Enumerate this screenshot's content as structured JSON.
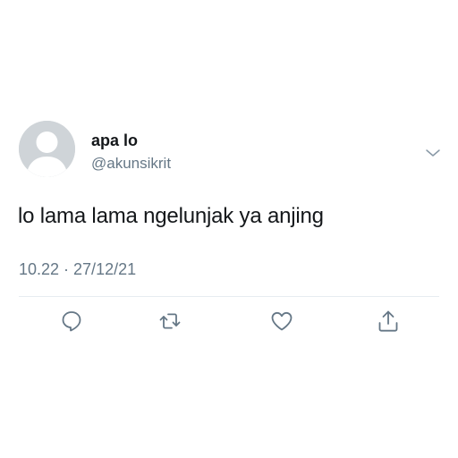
{
  "user": {
    "display_name": "apa lo",
    "handle": "@akunsikrit"
  },
  "tweet": {
    "text": "lo lama lama ngelunjak ya anjing",
    "timestamp": "10.22 · 27/12/21"
  },
  "icons": {
    "menu": "chevron-down-icon",
    "reply": "reply-icon",
    "retweet": "retweet-icon",
    "like": "heart-icon",
    "share": "share-icon"
  },
  "colors": {
    "text": "#14171a",
    "secondary": "#657786",
    "avatar_bg": "#cfd4d8",
    "divider": "#e6ecf0"
  }
}
